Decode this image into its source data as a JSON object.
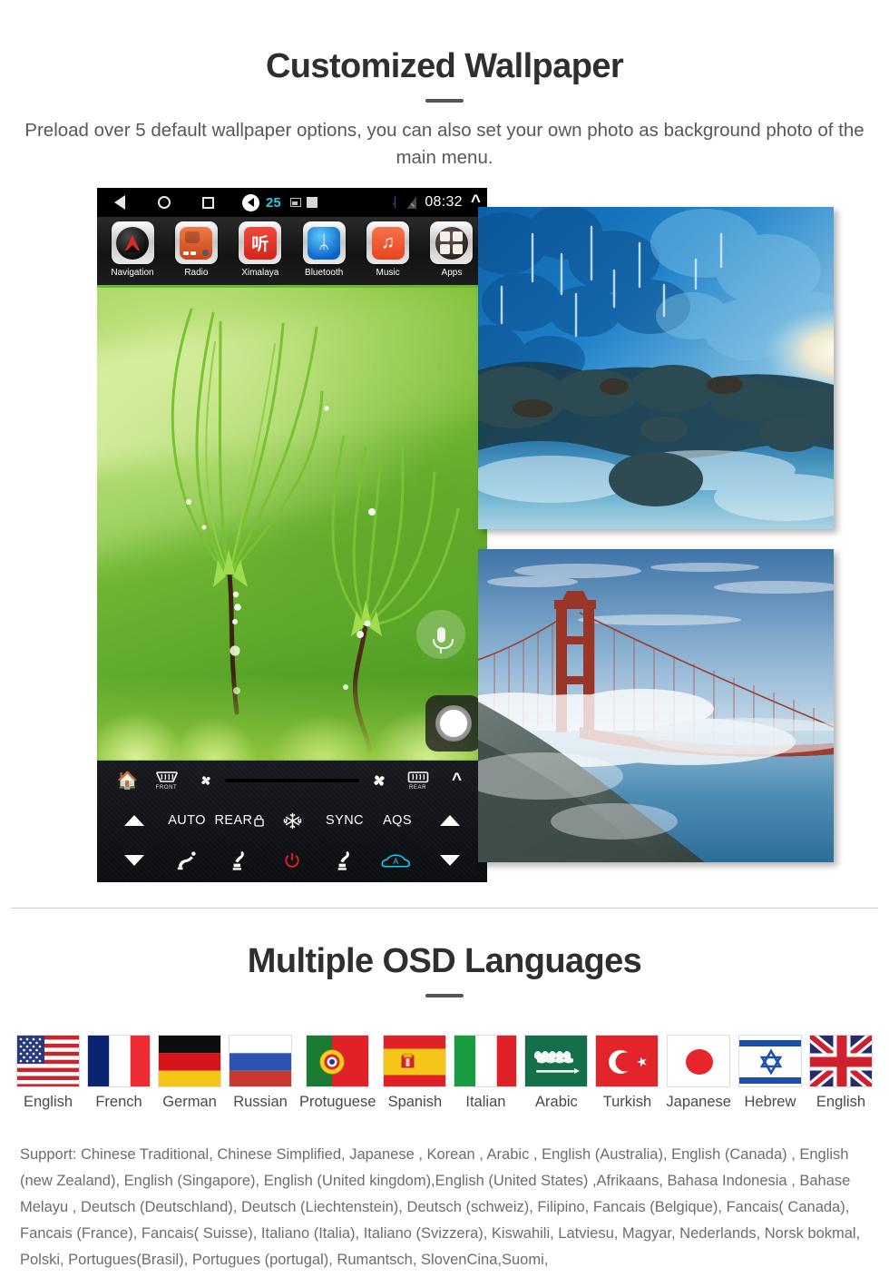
{
  "sections": {
    "wallpaper": {
      "title": "Customized Wallpaper",
      "subtitle": "Preload over 5 default wallpaper options, you can also set your own photo as background photo of the main menu."
    },
    "languages": {
      "title": "Multiple OSD Languages",
      "support_text": "Support: Chinese Traditional, Chinese Simplified, Japanese , Korean , Arabic , English (Australia), English (Canada) , English (new Zealand), English (Singapore), English (United kingdom),English (United States) ,Afrikaans, Bahasa Indonesia , Bahase Melayu , Deutsch (Deutschland), Deutsch (Liechtenstein), Deutsch (schweiz), Filipino, Fancais (Belgique), Fancais( Canada), Fancais (France), Fancais( Suisse), Italiano (Italia), Italiano (Svizzera), Kiswahili, Latviesu, Magyar, Nederlands, Norsk bokmal, Polski, Portugues(Brasil), Portugues (portugal), Rumantsch, SlovenCina,Suomi,"
    }
  },
  "device": {
    "statusbar": {
      "back_icon": "back-triangle-icon",
      "home_icon": "home-circle-icon",
      "recent_icon": "recent-square-icon",
      "volume_icon": "speaker-icon",
      "volume_value": "25",
      "screenshot_icon": "screenshot-icon",
      "stop_icon": "stop-square-icon",
      "bluetooth_icon": "bluetooth-icon",
      "signal_icon": "signal-off-icon",
      "time": "08:32",
      "expand_icon": "chevron-up-icon"
    },
    "apps": [
      {
        "label": "Navigation",
        "icon": "navigation-compass-icon"
      },
      {
        "label": "Radio",
        "icon": "radio-icon"
      },
      {
        "label": "Ximalaya",
        "icon": "ximalaya-icon",
        "glyph": "听"
      },
      {
        "label": "Bluetooth",
        "icon": "bluetooth-app-icon",
        "glyph": "ᛦ"
      },
      {
        "label": "Music",
        "icon": "music-note-icon",
        "glyph": "♫"
      },
      {
        "label": "Apps",
        "icon": "apps-grid-icon"
      }
    ],
    "wallpaper_fab": {
      "mic_icon": "microphone-icon",
      "home_icon": "home-button-icon"
    },
    "climate": {
      "home_icon": "home-icon",
      "front_defrost_label": "FRONT",
      "rear_defrost_label": "REAR",
      "fan_low_icon": "fan-small-icon",
      "fan_high_icon": "fan-large-icon",
      "expand_icon": "chevron-up-icon",
      "temp_up_left_icon": "triangle-up-icon",
      "temp_down_left_icon": "triangle-down-icon",
      "temp_up_right_icon": "triangle-up-icon",
      "temp_down_right_icon": "triangle-down-icon",
      "buttons": [
        "AUTO",
        "REAR",
        "SYNC",
        "AQS"
      ],
      "rear_lock_icon": "lock-icon",
      "ac_icon": "snowflake-icon",
      "power_icon": "power-icon",
      "airflow_face_body_icon": "airflow-face-body-icon",
      "airflow_foot_icon": "airflow-foot-icon",
      "airflow_foot2_icon": "airflow-foot-icon",
      "recirculation_icon": "air-recirculation-auto-icon"
    }
  },
  "wallpapers": [
    {
      "name": "main-green-sprout-wallpaper"
    },
    {
      "name": "ice-cave-wallpaper"
    },
    {
      "name": "golden-gate-bridge-fog-wallpaper"
    }
  ],
  "flags": [
    {
      "label": "English",
      "code": "us"
    },
    {
      "label": "French",
      "code": "fr"
    },
    {
      "label": "German",
      "code": "de"
    },
    {
      "label": "Russian",
      "code": "ru"
    },
    {
      "label": "Protuguese",
      "code": "pt"
    },
    {
      "label": "Spanish",
      "code": "es"
    },
    {
      "label": "Italian",
      "code": "it"
    },
    {
      "label": "Arabic",
      "code": "sa"
    },
    {
      "label": "Turkish",
      "code": "tr"
    },
    {
      "label": "Japanese",
      "code": "jp"
    },
    {
      "label": "Hebrew",
      "code": "il"
    },
    {
      "label": "English",
      "code": "gb"
    }
  ],
  "colors": {
    "heading": "#2f2f2f",
    "body_text": "#6d6d6d",
    "accent_green": "#6ab82e",
    "volume_cyan": "#2cc8d8",
    "power_red": "#ef1c1c",
    "aqs_cyan": "#17c8ef"
  }
}
